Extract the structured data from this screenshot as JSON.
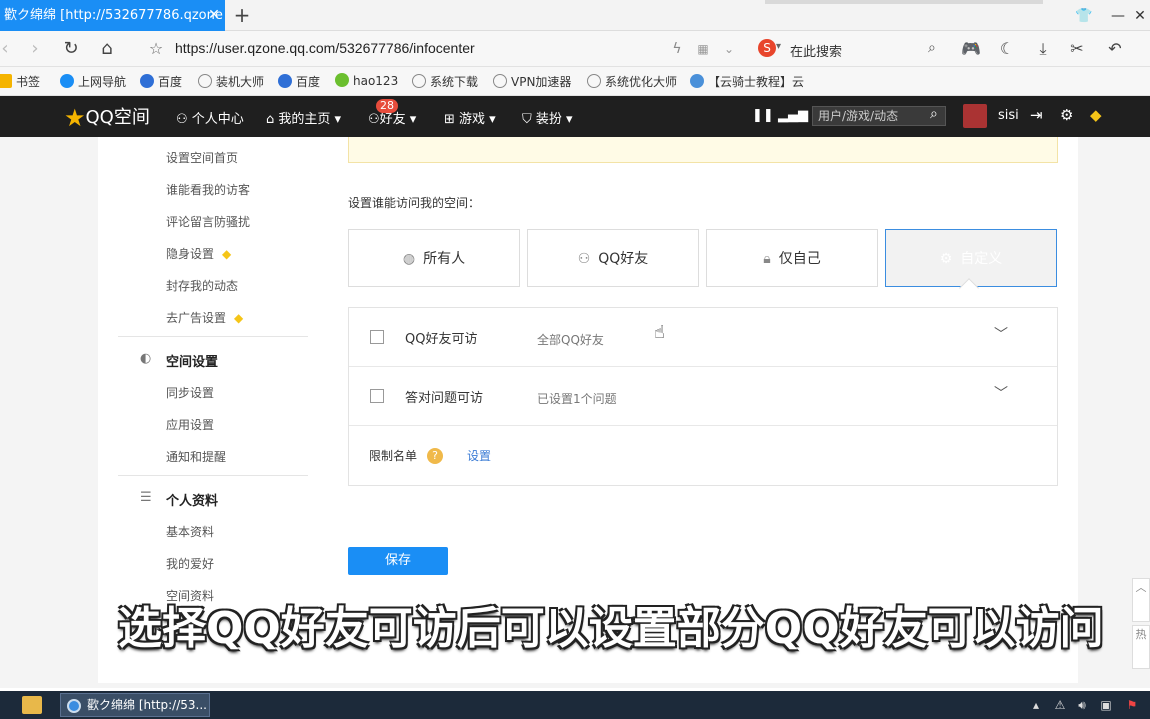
{
  "browser": {
    "tab_title": "歡ク绵绵 [http://532677786.qzone",
    "tab_close": "✕",
    "new_tab": "+",
    "url": "https://user.qzone.qq.com/532677786/infocenter",
    "search_placeholder": "在此搜索",
    "bookmarks": [
      "书签",
      "上网导航",
      "百度",
      "装机大师",
      "百度",
      "hao123",
      "系统下载",
      "VPN加速器",
      "系统优化大师",
      "【云骑士教程】云"
    ]
  },
  "qqbar": {
    "logo": "QQ空间",
    "nav": [
      "个人中心",
      "我的主页",
      "好友",
      "游戏",
      "装扮"
    ],
    "friends_badge": "28",
    "search_placeholder": "用户/游戏/动态",
    "username": "sisi"
  },
  "sidebar": {
    "privacy_items": [
      "设置空间首页",
      "谁能看我的访客",
      "评论留言防骚扰",
      "隐身设置",
      "封存我的动态",
      "去广告设置"
    ],
    "space_heading": "空间设置",
    "space_items": [
      "同步设置",
      "应用设置",
      "通知和提醒"
    ],
    "profile_heading": "个人资料",
    "profile_items": [
      "基本资料",
      "我的爱好",
      "空间资料"
    ]
  },
  "main": {
    "access_label": "设置谁能访问我的空间：",
    "options": [
      "所有人",
      "QQ好友",
      "仅自己",
      "自定义"
    ],
    "selected_option": "自定义",
    "rows": [
      {
        "label": "QQ好友可访",
        "desc": "全部QQ好友",
        "checked": false
      },
      {
        "label": "答对问题可访",
        "desc": "已设置1个问题",
        "checked": false
      }
    ],
    "limit_label": "限制名单",
    "limit_help": "?",
    "limit_action": "设置",
    "save_label": "保存"
  },
  "caption": "选择QQ好友可访后可以设置部分QQ好友可以访问",
  "taskbar": {
    "item": "歡ク绵绵 [http://53..."
  },
  "colors": {
    "accent": "#1a8ef5",
    "qqbar_bg": "#1f1f1f",
    "diamond": "#f5c518"
  }
}
